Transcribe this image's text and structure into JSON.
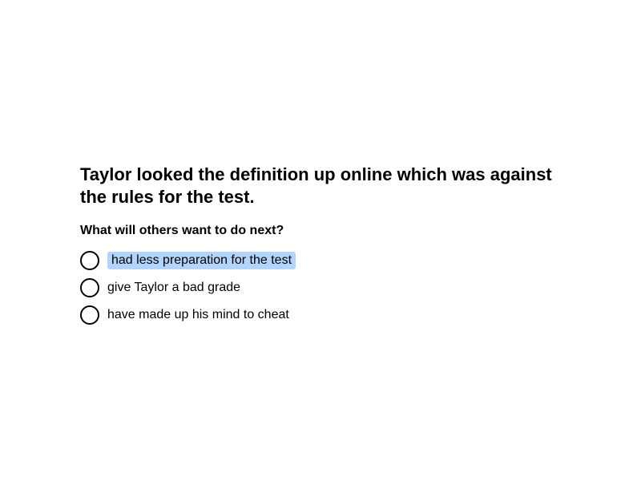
{
  "question": {
    "context": "Taylor looked the definition up online which was against the rules for the test.",
    "prompt": "What will others want to do next?"
  },
  "options": [
    {
      "label": "had less preparation for the test",
      "highlighted": true
    },
    {
      "label": "give Taylor a bad grade",
      "highlighted": false
    },
    {
      "label": "have made up his mind to cheat",
      "highlighted": false
    }
  ],
  "colors": {
    "text": "#000000",
    "background": "#ffffff",
    "highlight": "#b3d4fc"
  }
}
